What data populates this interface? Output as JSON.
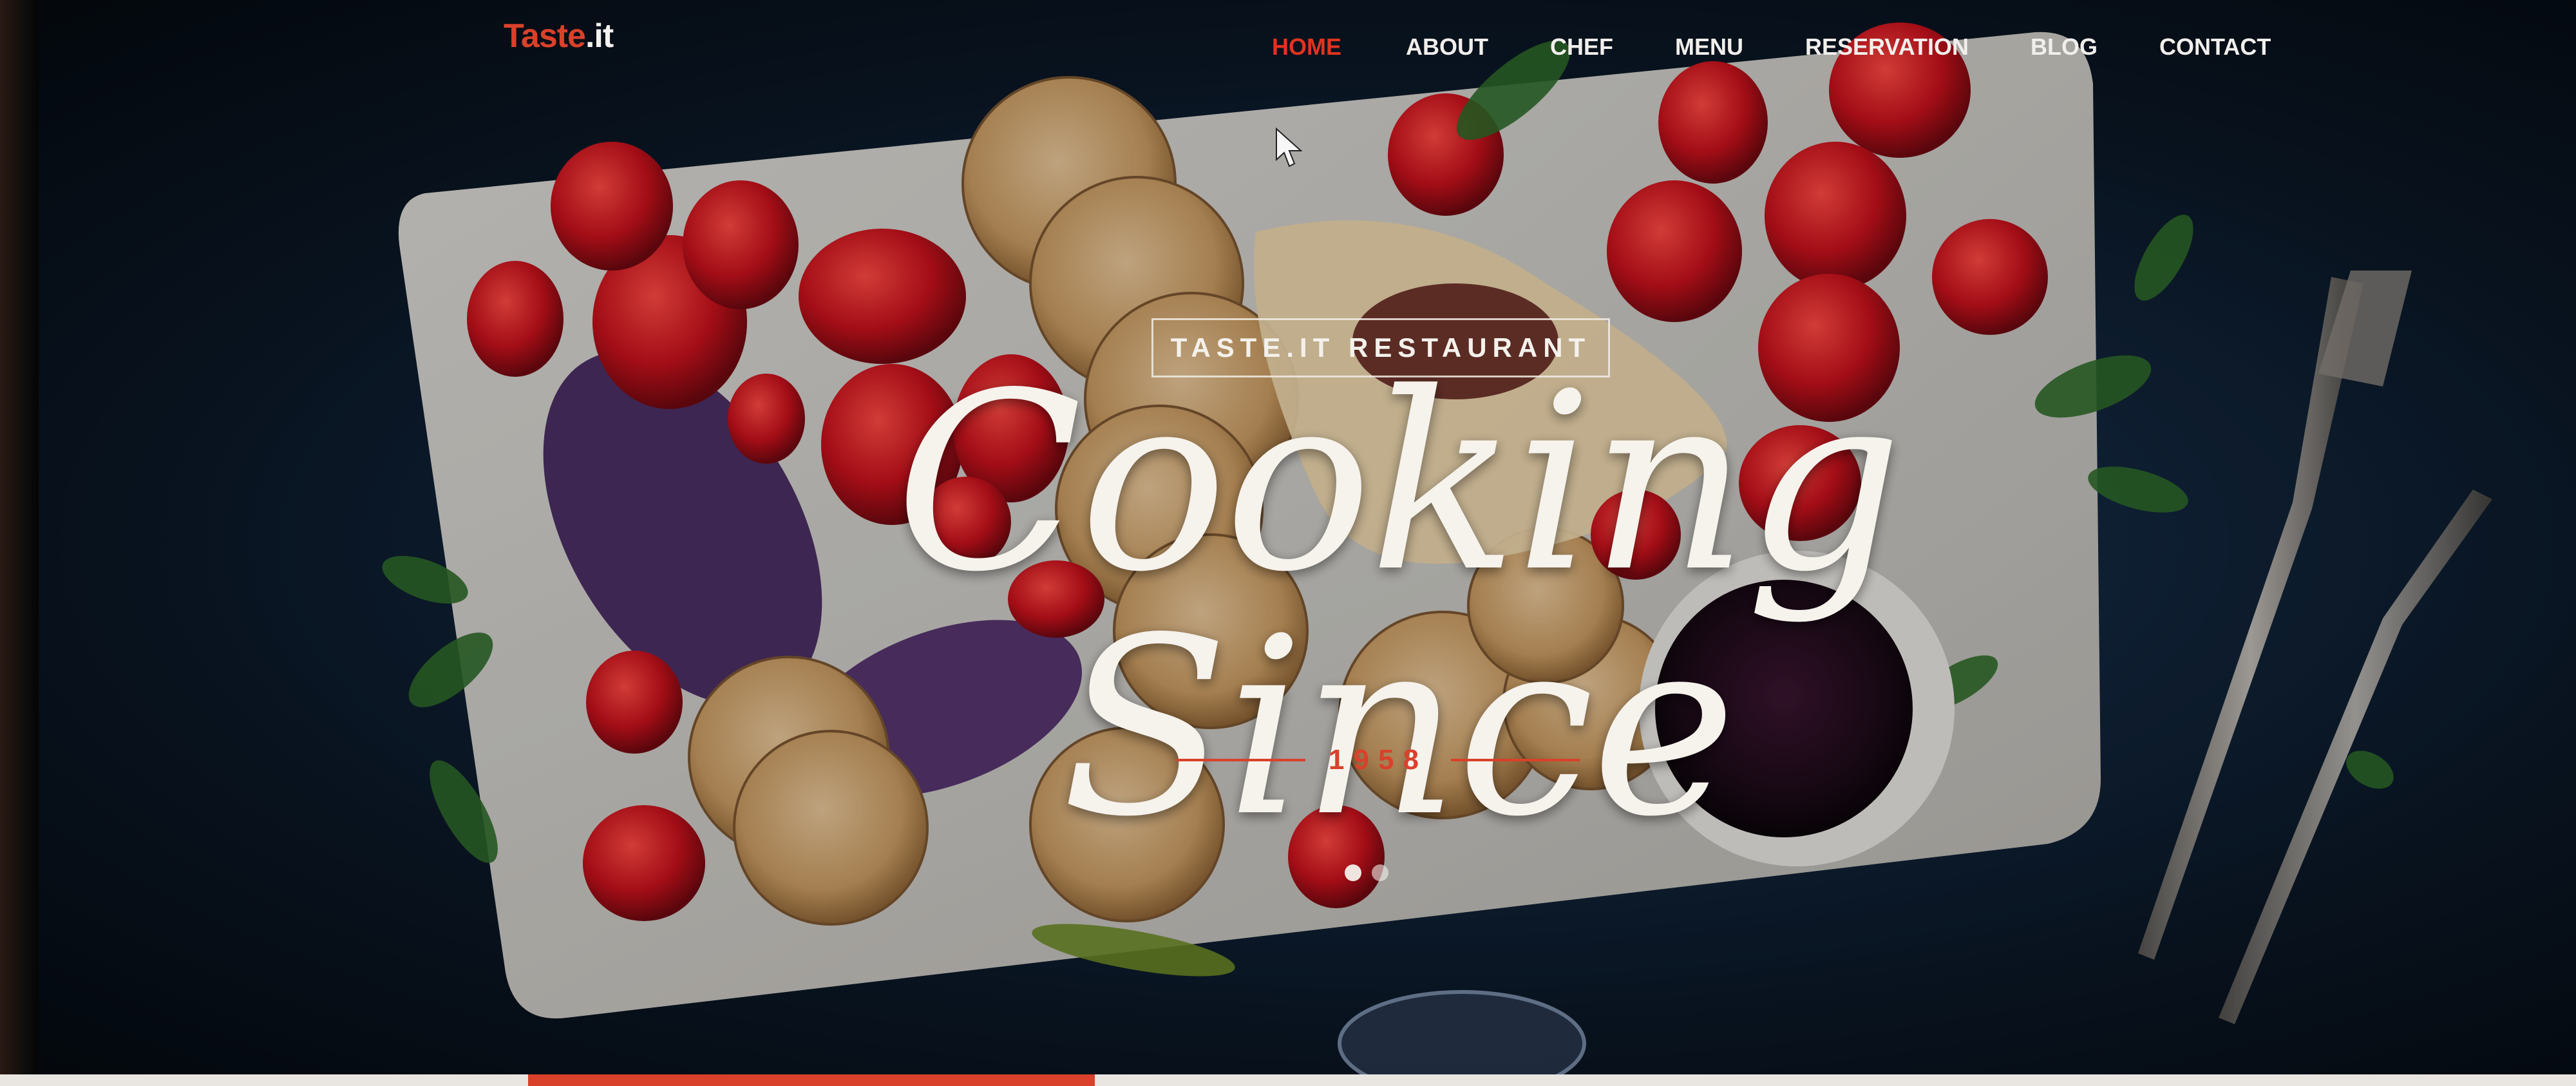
{
  "nav": {
    "logo_text": "Taste",
    "logo_suffix": ".it",
    "links": [
      {
        "label": "HOME",
        "active": true
      },
      {
        "label": "ABOUT",
        "active": false
      },
      {
        "label": "CHEF",
        "active": false
      },
      {
        "label": "MENU",
        "active": false
      },
      {
        "label": "RESERVATION",
        "active": false
      },
      {
        "label": "BLOG",
        "active": false
      },
      {
        "label": "CONTACT",
        "active": false
      }
    ]
  },
  "hero": {
    "tag": "TASTE.IT RESTAURANT",
    "title": "Cooking Since",
    "year": "1958",
    "slide_count": 2,
    "active_slide": 1
  },
  "colors": {
    "accent": "#d9412a",
    "text_light": "#f4f1ec",
    "background": "#12263d"
  },
  "icons": [
    "mouse-cursor-icon"
  ]
}
